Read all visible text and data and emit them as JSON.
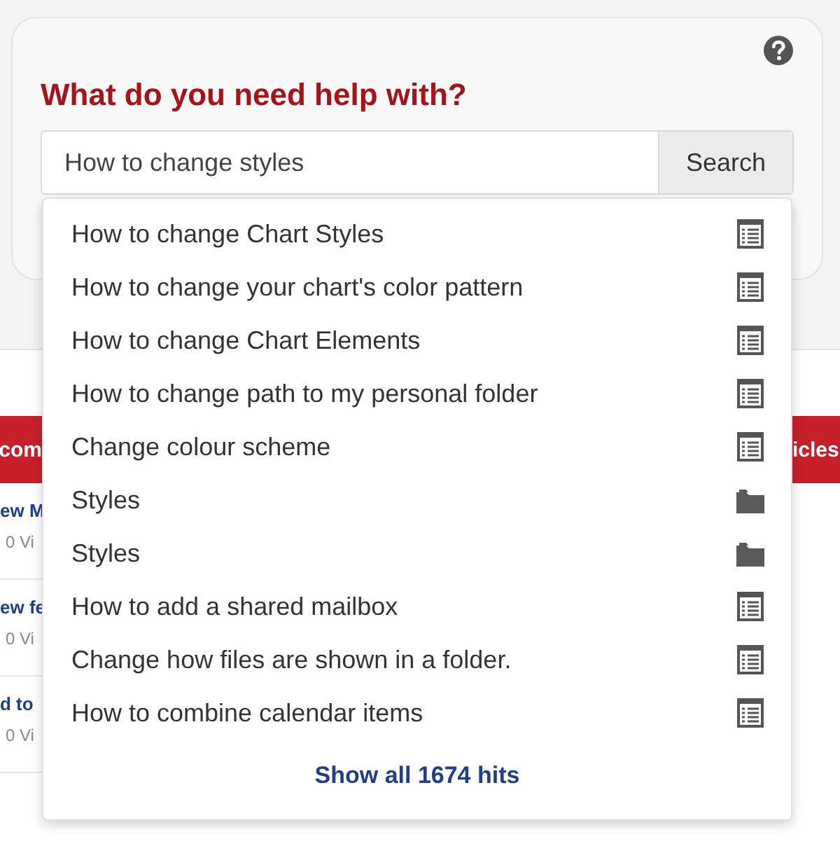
{
  "help_panel": {
    "title": "What do you need help with?",
    "search": {
      "value": "How to change styles"
    },
    "search_button": "Search"
  },
  "background": {
    "left_banner": "com",
    "right_banner": "icles",
    "articles": [
      {
        "title": "ew M",
        "views": "0 Vi"
      },
      {
        "title": "ew fe",
        "views": "0 Vi"
      },
      {
        "title": "d to",
        "views": "0 Vi"
      }
    ]
  },
  "suggestions": {
    "items": [
      {
        "label": "How to change Chart Styles",
        "kind": "article"
      },
      {
        "label": "How to change your chart's color pattern",
        "kind": "article"
      },
      {
        "label": "How to change Chart Elements",
        "kind": "article"
      },
      {
        "label": "How to change path to my personal folder",
        "kind": "article"
      },
      {
        "label": "Change colour scheme",
        "kind": "article"
      },
      {
        "label": "Styles",
        "kind": "folder"
      },
      {
        "label": "Styles",
        "kind": "folder"
      },
      {
        "label": "How to add a shared mailbox",
        "kind": "article"
      },
      {
        "label": "Change how files are shown in a folder.",
        "kind": "article"
      },
      {
        "label": "How to combine calendar items",
        "kind": "article"
      }
    ],
    "show_all": "Show all 1674 hits"
  }
}
